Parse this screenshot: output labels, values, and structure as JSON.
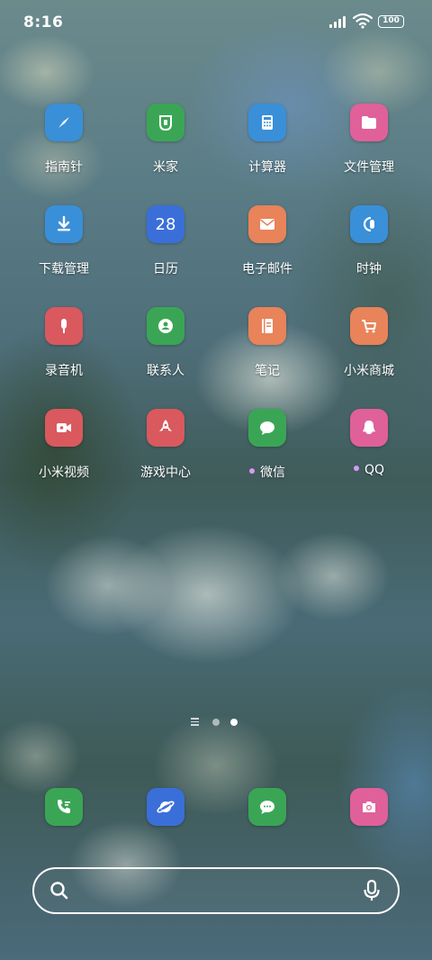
{
  "status_bar": {
    "time": "8:16",
    "battery": "100"
  },
  "apps": [
    {
      "label": "指南针",
      "icon": "compass-icon",
      "color": "#3a8fd9"
    },
    {
      "label": "米家",
      "icon": "mijia-icon",
      "color": "#3aa655"
    },
    {
      "label": "计算器",
      "icon": "calculator-icon",
      "color": "#3a8fd9"
    },
    {
      "label": "文件管理",
      "icon": "folder-icon",
      "color": "#e0609a"
    },
    {
      "label": "下载管理",
      "icon": "download-icon",
      "color": "#3a8fd9"
    },
    {
      "label": "日历",
      "icon": "calendar-icon",
      "color": "#3a6fd9",
      "day": "28"
    },
    {
      "label": "电子邮件",
      "icon": "mail-icon",
      "color": "#e8835a"
    },
    {
      "label": "时钟",
      "icon": "clock-icon",
      "color": "#3a8fd9"
    },
    {
      "label": "录音机",
      "icon": "recorder-icon",
      "color": "#d9595e"
    },
    {
      "label": "联系人",
      "icon": "contacts-icon",
      "color": "#3aa655"
    },
    {
      "label": "笔记",
      "icon": "notes-icon",
      "color": "#e8835a"
    },
    {
      "label": "小米商城",
      "icon": "shop-cart-icon",
      "color": "#e8835a"
    },
    {
      "label": "小米视频",
      "icon": "video-icon",
      "color": "#d9595e"
    },
    {
      "label": "游戏中心",
      "icon": "game-rocket-icon",
      "color": "#d9595e"
    },
    {
      "label": "微信",
      "icon": "wechat-icon",
      "color": "#3aa655",
      "new_dot": true
    },
    {
      "label": "QQ",
      "icon": "qq-icon",
      "color": "#e0609a",
      "new_dot": true
    }
  ],
  "page_indicator": {
    "pages": 2,
    "current": 2
  },
  "dock": [
    {
      "icon": "phone-icon",
      "color": "#3aa655"
    },
    {
      "icon": "browser-planet-icon",
      "color": "#3a6fd9"
    },
    {
      "icon": "messages-icon",
      "color": "#3aa655"
    },
    {
      "icon": "camera-icon",
      "color": "#e0609a"
    }
  ]
}
